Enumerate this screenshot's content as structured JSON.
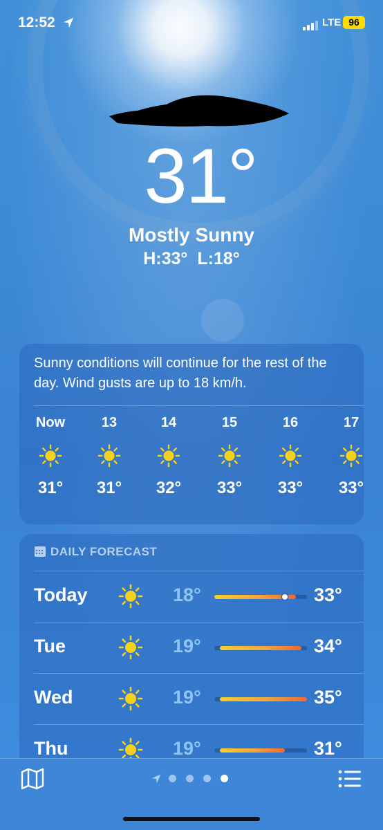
{
  "status_bar": {
    "time": "12:52",
    "network": "LTE",
    "battery": "96"
  },
  "current": {
    "temperature": "31°",
    "condition": "Mostly Sunny",
    "high": "H:33°",
    "low": "L:18°"
  },
  "hourly": {
    "summary": "Sunny conditions will continue for the rest of the day. Wind gusts are up to 18 km/h.",
    "hours": [
      {
        "label": "Now",
        "icon": "sun-icon",
        "temp": "31°"
      },
      {
        "label": "13",
        "icon": "sun-icon",
        "temp": "31°"
      },
      {
        "label": "14",
        "icon": "sun-icon",
        "temp": "32°"
      },
      {
        "label": "15",
        "icon": "sun-icon",
        "temp": "33°"
      },
      {
        "label": "16",
        "icon": "sun-icon",
        "temp": "33°"
      },
      {
        "label": "17",
        "icon": "sun-icon",
        "temp": "33°"
      }
    ]
  },
  "daily": {
    "header": "DAILY FORECAST",
    "range_min": 18,
    "range_max": 35,
    "days": [
      {
        "name": "Today",
        "icon": "sun-icon",
        "low": "18°",
        "high": "33°",
        "low_val": 18,
        "high_val": 33,
        "current_val": 31
      },
      {
        "name": "Tue",
        "icon": "sun-icon",
        "low": "19°",
        "high": "34°",
        "low_val": 19,
        "high_val": 34
      },
      {
        "name": "Wed",
        "icon": "sun-icon",
        "low": "19°",
        "high": "35°",
        "low_val": 19,
        "high_val": 35
      },
      {
        "name": "Thu",
        "icon": "sun-icon",
        "low": "19°",
        "high": "31°",
        "low_val": 19,
        "high_val": 31
      }
    ]
  },
  "bottom_bar": {
    "page_count": 4,
    "active_page": 4
  },
  "colors": {
    "sky": "#3d8ad6",
    "sun": "#f7d21c",
    "battery": "#ffdc00"
  }
}
